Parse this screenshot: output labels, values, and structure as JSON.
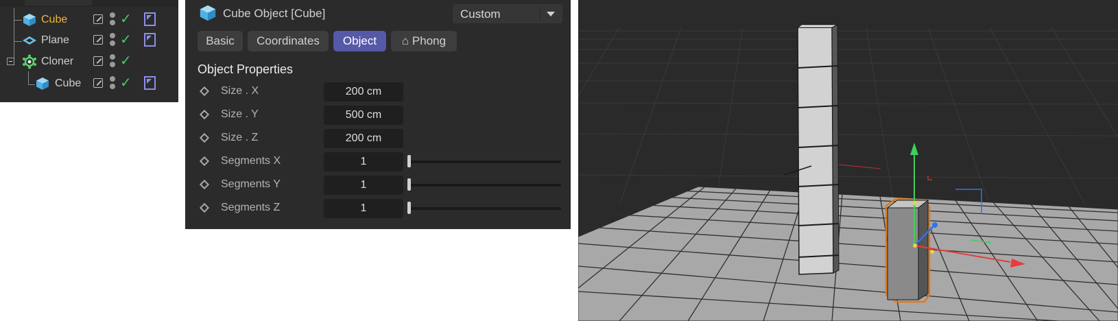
{
  "object_manager": {
    "items": [
      {
        "label": "Cube",
        "icon": "cube-icon",
        "selected": true
      },
      {
        "label": "Plane",
        "icon": "plane-icon"
      },
      {
        "label": "Cloner",
        "icon": "cloner-icon",
        "expanded": true
      },
      {
        "label": "Cube",
        "icon": "cube-icon",
        "child": true
      }
    ]
  },
  "attributes": {
    "title": "Cube Object [Cube]",
    "mode": "Custom",
    "tabs": [
      {
        "label": "Basic"
      },
      {
        "label": "Coordinates"
      },
      {
        "label": "Object",
        "active": true
      },
      {
        "label": "⌂ Phong"
      }
    ],
    "section": "Object Properties",
    "params": [
      {
        "label": "Size . X",
        "value": "200 cm"
      },
      {
        "label": "Size . Y",
        "value": "500 cm"
      },
      {
        "label": "Size . Z",
        "value": "200 cm"
      },
      {
        "label": "Segments X",
        "value": "1",
        "slider": 0
      },
      {
        "label": "Segments Y",
        "value": "1",
        "slider": 0
      },
      {
        "label": "Segments Z",
        "value": "1",
        "slider": 0
      }
    ]
  },
  "colors": {
    "selected_label": "#f0b53a",
    "active_tab": "#5658a8",
    "check": "#3fd05a",
    "tag": "#8e8ee8",
    "selection_outline": "#e07a1a"
  }
}
